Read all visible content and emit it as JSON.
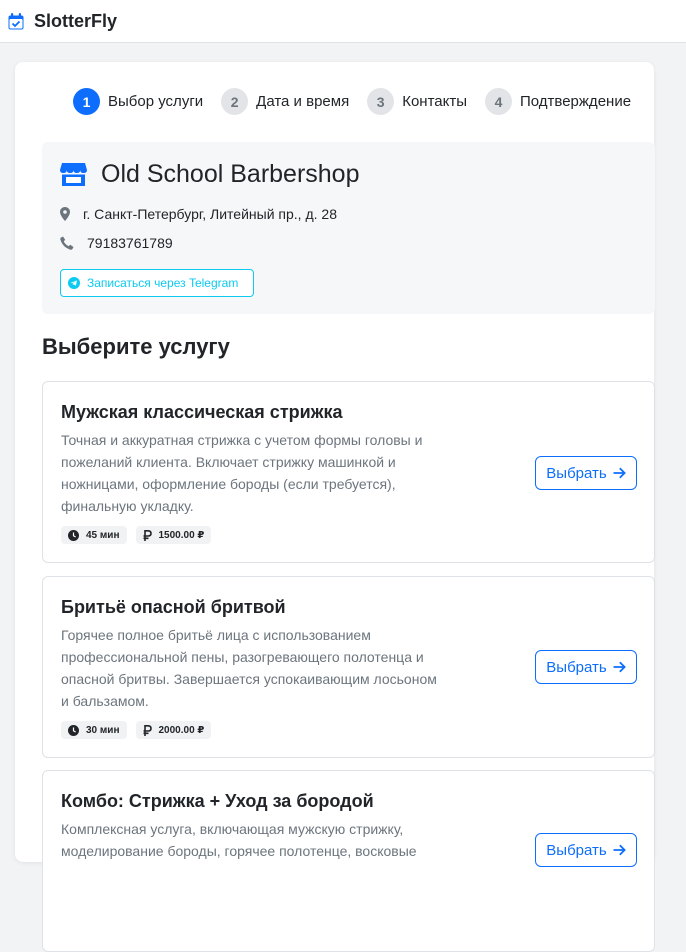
{
  "app": {
    "name": "SlotterFly"
  },
  "steps": [
    {
      "num": "1",
      "label": "Выбор услуги",
      "active": true
    },
    {
      "num": "2",
      "label": "Дата и время",
      "active": false
    },
    {
      "num": "3",
      "label": "Контакты",
      "active": false
    },
    {
      "num": "4",
      "label": "Подтверждение",
      "active": false
    }
  ],
  "shop": {
    "name": "Old School Barbershop",
    "address": "г. Санкт-Петербург, Литейный пр., д. 28",
    "phone": "79183761789",
    "telegram_label": "Записаться через Telegram"
  },
  "section_title": "Выберите услугу",
  "services": [
    {
      "name": "Мужская классическая стрижка",
      "description": "Точная и аккуратная стрижка с учетом формы головы и пожеланий клиента. Включает стрижку машинкой и ножницами, оформление бороды (если требуется), финальную укладку.",
      "duration": "45 мин",
      "price": "1500.00 ₽",
      "button": "Выбрать"
    },
    {
      "name": "Бритьё опасной бритвой",
      "description": "Горячее полное бритьё лица с использованием профессиональной пены, разогревающего полотенца и опасной бритвы. Завершается успокаивающим лосьоном и бальзамом.",
      "duration": "30 мин",
      "price": "2000.00 ₽",
      "button": "Выбрать"
    },
    {
      "name": "Комбо: Стрижка + Уход за бородой",
      "description": "Комплексная услуга, включающая мужскую стрижку, моделирование бороды, горячее полотенце, восковые",
      "button": "Выбрать"
    }
  ],
  "colors": {
    "primary": "#0d6efd",
    "telegram": "#0dcaf0",
    "muted": "#6c757d"
  },
  "icons": {
    "brand": "calendar-check-icon",
    "shop": "store-icon",
    "address": "map-marker-icon",
    "phone": "phone-icon",
    "telegram": "telegram-icon",
    "duration": "clock-icon",
    "price": "ruble-icon",
    "select": "arrow-right-icon"
  }
}
